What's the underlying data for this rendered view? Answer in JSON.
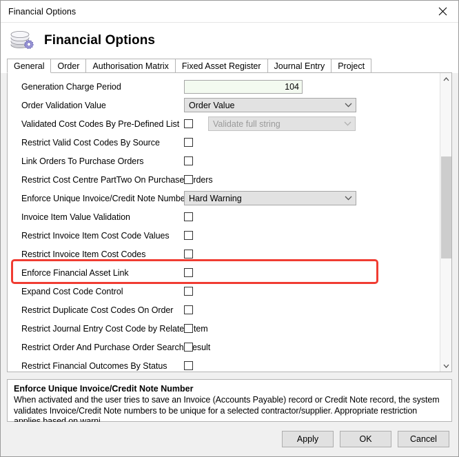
{
  "window": {
    "title": "Financial Options",
    "close_icon": "close-icon"
  },
  "header": {
    "title": "Financial Options",
    "icon": "coins-gear-icon"
  },
  "tabs": [
    {
      "label": "General",
      "active": true
    },
    {
      "label": "Order",
      "active": false
    },
    {
      "label": "Authorisation Matrix",
      "active": false
    },
    {
      "label": "Fixed Asset Register",
      "active": false
    },
    {
      "label": "Journal Entry",
      "active": false
    },
    {
      "label": "Project",
      "active": false
    }
  ],
  "options": [
    {
      "label": "Generation Charge Period",
      "control": "text",
      "value": "104"
    },
    {
      "label": "Order Validation Value",
      "control": "dropdown",
      "value": "Order Value",
      "disabled": false
    },
    {
      "label": "Validated Cost Codes By Pre-Defined List",
      "control": "checkbox-dropdown",
      "checked": false,
      "value": "Validate full string",
      "disabled": true
    },
    {
      "label": "Restrict Valid Cost Codes By Source",
      "control": "checkbox",
      "checked": false
    },
    {
      "label": "Link Orders To Purchase Orders",
      "control": "checkbox",
      "checked": false
    },
    {
      "label": "Restrict Cost Centre PartTwo On Purchase Orders",
      "control": "checkbox",
      "checked": false
    },
    {
      "label": "Enforce Unique Invoice/Credit Note Number",
      "control": "dropdown",
      "value": "Hard Warning",
      "disabled": false,
      "highlighted": true
    },
    {
      "label": "Invoice Item Value Validation",
      "control": "checkbox",
      "checked": false
    },
    {
      "label": "Restrict Invoice Item Cost Code Values",
      "control": "checkbox",
      "checked": false
    },
    {
      "label": "Restrict Invoice Item Cost Codes",
      "control": "checkbox",
      "checked": false
    },
    {
      "label": "Enforce Financial Asset Link",
      "control": "checkbox",
      "checked": false
    },
    {
      "label": "Expand Cost Code Control",
      "control": "checkbox",
      "checked": false
    },
    {
      "label": "Restrict Duplicate Cost Codes On Order",
      "control": "checkbox",
      "checked": false
    },
    {
      "label": "Restrict Journal Entry Cost Code by Related Item",
      "control": "checkbox",
      "checked": false
    },
    {
      "label": "Restrict Order And Purchase Order Search Result",
      "control": "checkbox",
      "checked": false
    },
    {
      "label": "Restrict Financial Outcomes By Status",
      "control": "checkbox",
      "checked": false
    }
  ],
  "scrollbar": {
    "up_icon": "chevron-up-icon",
    "down_icon": "chevron-down-icon"
  },
  "description": {
    "title": "Enforce Unique Invoice/Credit Note Number",
    "body": "When activated and the user tries to save an Invoice (Accounts Payable) record or Credit Note record, the system validates Invoice/Credit Note numbers to be unique for a selected contractor/supplier. Appropriate restriction applies based on warni..."
  },
  "footer": {
    "apply": "Apply",
    "ok": "OK",
    "cancel": "Cancel"
  },
  "colors": {
    "highlight": "#f03c32",
    "input_bg": "#f3faf0",
    "dropdown_bg": "#e2e2e2"
  }
}
